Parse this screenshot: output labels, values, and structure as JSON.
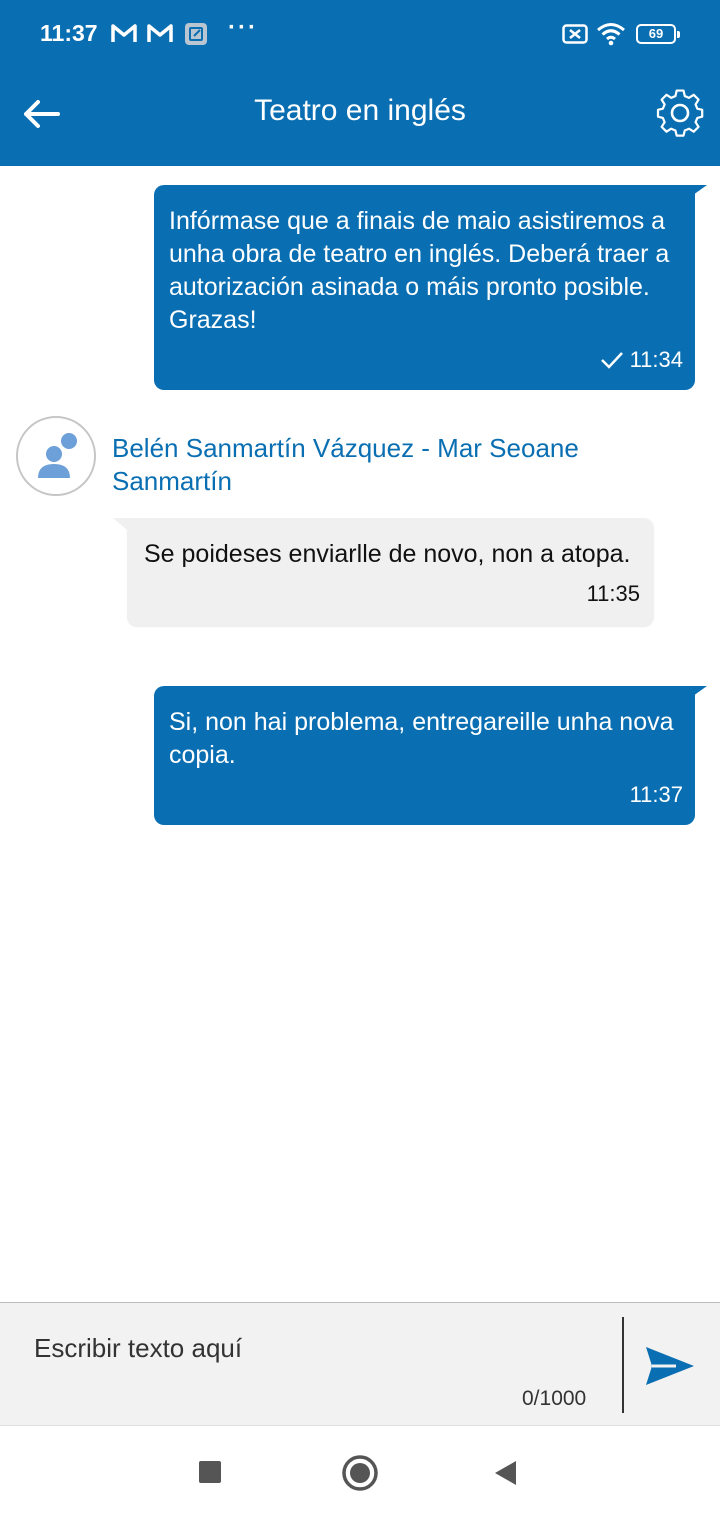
{
  "status_bar": {
    "time": "11:37",
    "battery": "69",
    "icons": [
      "gmail-icon",
      "gmail-icon",
      "screenshot-icon",
      "more-dots-icon",
      "sim-off-icon",
      "wifi-icon",
      "battery-icon"
    ],
    "dots": "···"
  },
  "app_bar": {
    "title": "Teatro en inglés",
    "back_icon": "arrow-left-icon",
    "settings_icon": "gear-icon",
    "color": "#0a6fb2"
  },
  "messages": [
    {
      "direction": "outgoing",
      "text": "Infórmase que a finais de maio asistiremos a unha obra de teatro en inglés. Deberá traer a autorización asinada o máis pronto posible. Grazas!",
      "time": "11:34",
      "read_check": true
    },
    {
      "direction": "incoming",
      "sender": "Belén Sanmartín Vázquez -  Mar Seoane Sanmartín",
      "text": "Se poideses enviarlle de novo, non a atopa.",
      "time": "11:35"
    },
    {
      "direction": "outgoing",
      "text": "Si, non hai problema, entregareille unha nova copia.",
      "time": "11:37",
      "read_check": false
    }
  ],
  "composer": {
    "placeholder": "Escribir texto aquí",
    "counter": "0/1000",
    "send_icon": "send-icon"
  },
  "nav_bar": {
    "icons": [
      "recents-square-icon",
      "home-circle-icon",
      "back-triangle-icon"
    ]
  }
}
